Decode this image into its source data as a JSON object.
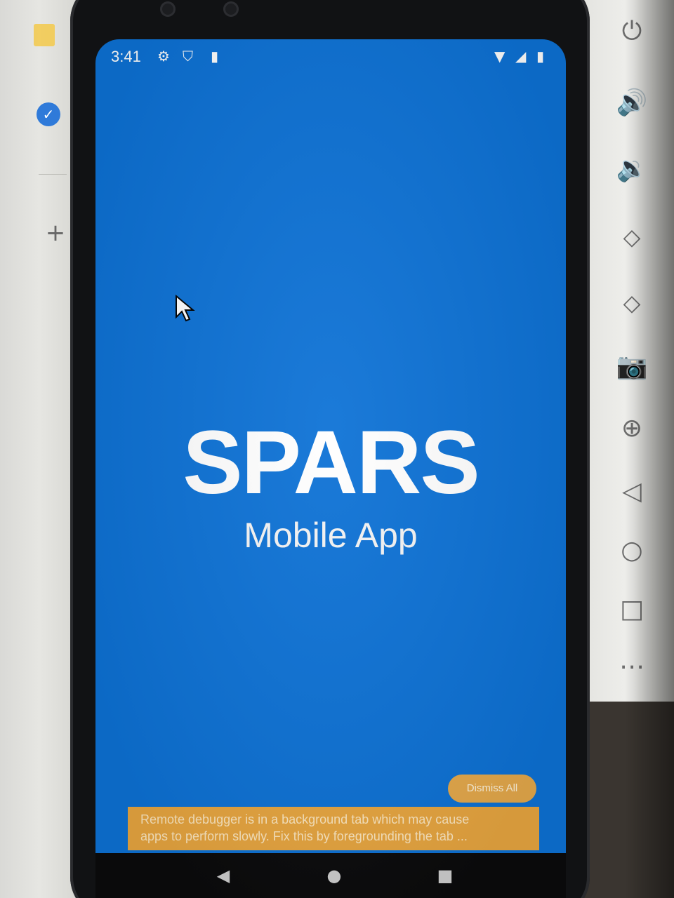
{
  "status_bar": {
    "time": "3:41",
    "icons": [
      "gear-icon",
      "shield-icon",
      "sd-card-icon",
      "wifi-icon",
      "signal-icon",
      "battery-icon"
    ]
  },
  "splash": {
    "title": "SPARS",
    "subtitle": "Mobile App",
    "background_color": "#0d72d6"
  },
  "debug": {
    "dismiss_label": "Dismiss All",
    "warning_line1": "Remote debugger is in a background tab which may cause",
    "warning_line2": "apps to perform slowly. Fix this by foregrounding the tab ...",
    "banner_color": "#e8a640"
  },
  "nav_bar": {
    "icons": [
      "back-icon",
      "home-icon",
      "recents-icon"
    ]
  },
  "emulator_toolbar": {
    "icons": [
      "power-icon",
      "volume-up-icon",
      "volume-down-icon",
      "rotate-left-icon",
      "rotate-right-icon",
      "camera-icon",
      "zoom-icon",
      "back-icon",
      "home-icon",
      "overview-icon",
      "more-icon"
    ]
  },
  "host_sidebar": {
    "icons": [
      "sticky-note-icon",
      "check-icon",
      "add-icon"
    ]
  }
}
